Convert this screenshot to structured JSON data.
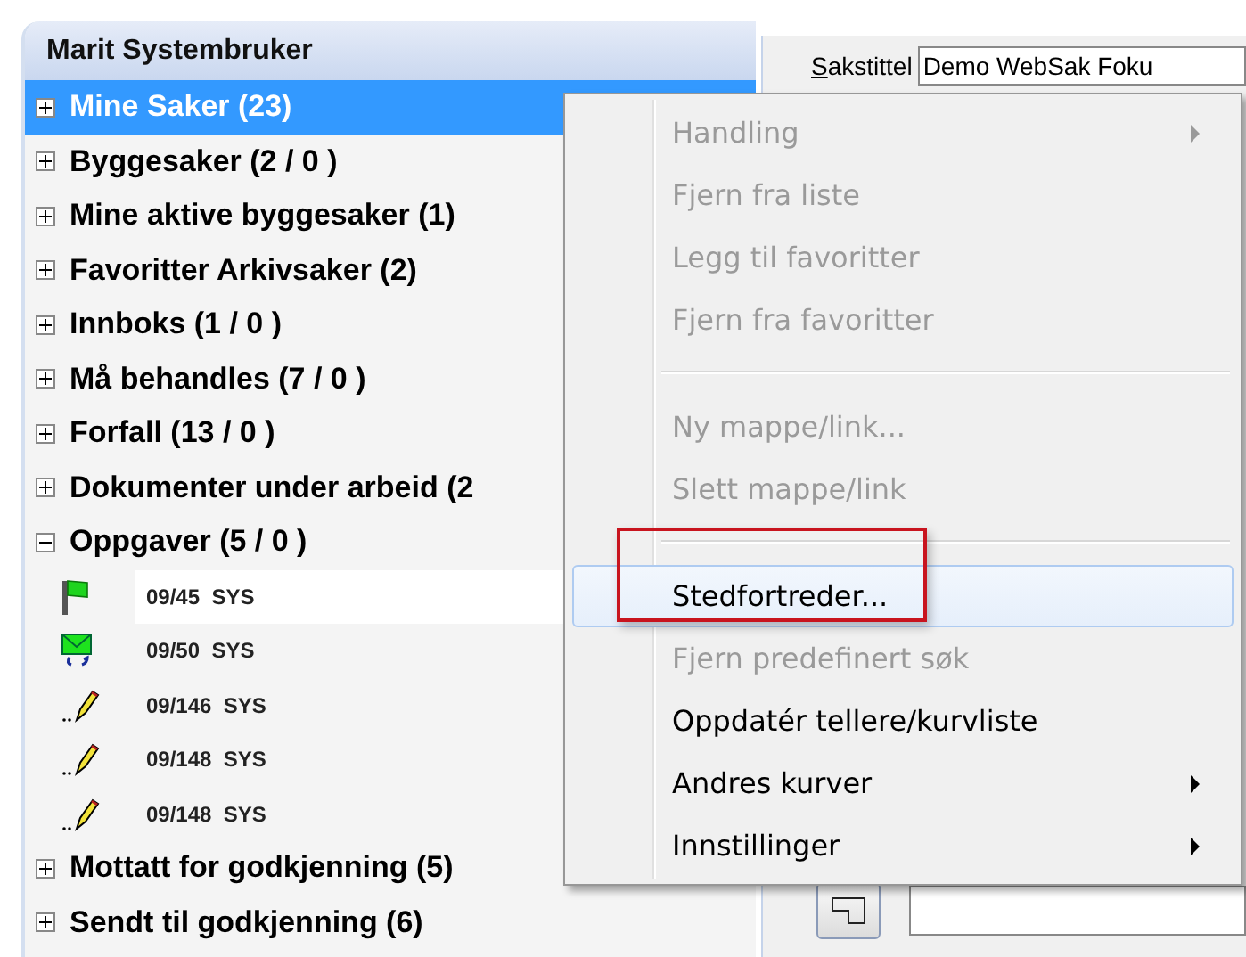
{
  "tree_panel": {
    "title": "Marit Systembruker",
    "nodes": [
      {
        "label": "Mine Saker (23)",
        "expanded": false,
        "selected": true
      },
      {
        "label": "Byggesaker (2 / 0 )",
        "expanded": false,
        "selected": false
      },
      {
        "label": "Mine aktive byggesaker (1)",
        "expanded": false,
        "selected": false
      },
      {
        "label": "Favoritter Arkivsaker (2)",
        "expanded": false,
        "selected": false
      },
      {
        "label": "Innboks (1 / 0 )",
        "expanded": false,
        "selected": false
      },
      {
        "label": "Må behandles (7 / 0 )",
        "expanded": false,
        "selected": false
      },
      {
        "label": "Forfall (13 / 0 )",
        "expanded": false,
        "selected": false
      },
      {
        "label": "Dokumenter under arbeid (2",
        "expanded": false,
        "selected": false
      },
      {
        "label": "Oppgaver (5 / 0 )",
        "expanded": true,
        "selected": false,
        "children": [
          {
            "label": "09/45  SYS",
            "kind": "flag",
            "selected": true
          },
          {
            "label": "09/50  SYS",
            "kind": "mail",
            "selected": false
          },
          {
            "label": "09/146  SYS",
            "kind": "pencil",
            "selected": false
          },
          {
            "label": "09/148  SYS",
            "kind": "pencil",
            "selected": false
          },
          {
            "label": "09/148  SYS",
            "kind": "pencil",
            "selected": false
          }
        ]
      },
      {
        "label": "Mottatt for godkjenning (5)",
        "expanded": false,
        "selected": false
      },
      {
        "label": "Sendt til godkjenning (6)",
        "expanded": false,
        "selected": false
      }
    ]
  },
  "detail_panel": {
    "title_label": "Sakstittel",
    "title_value": "Demo WebSak Foku"
  },
  "context_menu": {
    "items": [
      {
        "kind": "item",
        "label": "Handling",
        "disabled": true,
        "submenu": true,
        "highlighted": false
      },
      {
        "kind": "item",
        "label": "Fjern fra liste",
        "disabled": true,
        "submenu": false,
        "highlighted": false
      },
      {
        "kind": "item",
        "label": "Legg til favoritter",
        "disabled": true,
        "submenu": false,
        "highlighted": false
      },
      {
        "kind": "item",
        "label": "Fjern fra favoritter",
        "disabled": true,
        "submenu": false,
        "highlighted": false
      },
      {
        "kind": "separator"
      },
      {
        "kind": "item",
        "label": "Ny mappe/link...",
        "disabled": true,
        "submenu": false,
        "highlighted": false
      },
      {
        "kind": "item",
        "label": "Slett mappe/link",
        "disabled": true,
        "submenu": false,
        "highlighted": false
      },
      {
        "kind": "separator"
      },
      {
        "kind": "item",
        "label": "Stedfortreder...",
        "disabled": false,
        "submenu": false,
        "highlighted": true
      },
      {
        "kind": "item",
        "label": "Fjern predefinert søk",
        "disabled": true,
        "submenu": false,
        "highlighted": false
      },
      {
        "kind": "item",
        "label": "Oppdatér tellere/kurvliste",
        "disabled": false,
        "submenu": false,
        "highlighted": false
      },
      {
        "kind": "item",
        "label": "Andres kurver",
        "disabled": false,
        "submenu": true,
        "highlighted": false
      },
      {
        "kind": "item",
        "label": "Innstillinger",
        "disabled": false,
        "submenu": true,
        "highlighted": false
      }
    ]
  }
}
